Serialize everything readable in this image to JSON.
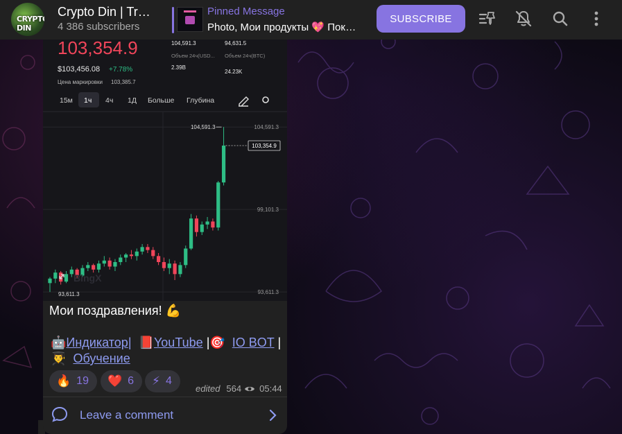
{
  "header": {
    "channel_title": "Crypto Din | Trading",
    "avatar_text": "CRYPTO DIN",
    "subscribers": "4 386 subscribers",
    "pinned_label": "Pinned Message",
    "pinned_text": "Photo, Мои продукты 💖 Показать все",
    "subscribe_label": "SUBSCRIBE",
    "icons": [
      "pinned-list-icon",
      "mute-icon",
      "search-icon",
      "more-vertical-icon"
    ]
  },
  "chart_screenshot": {
    "price": "103,354.9",
    "price_usd": "$103,456.08",
    "change": "+7.78%",
    "mark_price_label": "Цена маркировки",
    "mark_price": "103,385.7",
    "high_label": "",
    "high": "104,591.3",
    "low": "94,631.5",
    "vol_usd_label": "Объем 24ч(USD...",
    "vol_usd": "2.39B",
    "vol_btc_label": "Объем 24ч(BTC)",
    "vol_btc": "24.23K",
    "timeframes": [
      "15м",
      "1ч",
      "4ч",
      "1Д",
      "Больше",
      "Глубина"
    ],
    "active_timeframe": "1ч",
    "peak_label": "104,591.3",
    "low_label": "93,611.3",
    "watermark": "BingX",
    "axis_ticks": [
      "104,591.3",
      "99,101.3",
      "93,611.3"
    ],
    "current_price_tag": "103,354.9",
    "candles": [
      [
        94200,
        94600,
        93611,
        94500
      ],
      [
        94500,
        95100,
        94200,
        94900
      ],
      [
        94900,
        95000,
        94100,
        94300
      ],
      [
        94300,
        95000,
        94200,
        94800
      ],
      [
        94800,
        95300,
        94600,
        95100
      ],
      [
        95100,
        95200,
        94500,
        94700
      ],
      [
        94700,
        95400,
        94600,
        95200
      ],
      [
        95200,
        95600,
        95000,
        95400
      ],
      [
        95400,
        95500,
        94900,
        95100
      ],
      [
        95100,
        95700,
        94900,
        95500
      ],
      [
        95500,
        96000,
        95300,
        95700
      ],
      [
        95700,
        95900,
        95100,
        95300
      ],
      [
        95300,
        95800,
        95000,
        95600
      ],
      [
        95600,
        96100,
        95400,
        95900
      ],
      [
        95900,
        96200,
        95600,
        96100
      ],
      [
        96100,
        96400,
        95800,
        96000
      ],
      [
        96000,
        96500,
        95700,
        96300
      ],
      [
        96300,
        96800,
        96100,
        96600
      ],
      [
        96600,
        96800,
        96200,
        96400
      ],
      [
        96400,
        96600,
        95800,
        96000
      ],
      [
        96000,
        96200,
        95400,
        95600
      ],
      [
        95600,
        95900,
        95000,
        95200
      ],
      [
        95200,
        95800,
        94800,
        95500
      ],
      [
        95500,
        95700,
        94400,
        94800
      ],
      [
        94800,
        95600,
        94600,
        95400
      ],
      [
        95400,
        96700,
        95200,
        96500
      ],
      [
        96500,
        98800,
        96400,
        98500
      ],
      [
        98500,
        98700,
        97300,
        97600
      ],
      [
        97600,
        98300,
        97400,
        98100
      ],
      [
        98100,
        98600,
        97800,
        98300
      ],
      [
        98300,
        98500,
        97700,
        97900
      ],
      [
        97900,
        101000,
        97700,
        100900
      ],
      [
        100900,
        104591,
        100700,
        103355
      ]
    ]
  },
  "message": {
    "caption": "Мои поздравления! 💪",
    "links_prefix_emoji": "🤖",
    "link_indicator": "Индикатор",
    "sep1": "|",
    "youtube_emoji": "📕",
    "link_youtube": "YouTube",
    "sep2": "|🎯",
    "link_iobot": "IO BOT",
    "sep3": "|",
    "edu_emoji": "👨‍🎓",
    "link_learning": "Обучение",
    "reactions": [
      {
        "emoji": "🔥",
        "count": "19"
      },
      {
        "emoji": "❤️",
        "count": "6"
      },
      {
        "emoji": "⚡",
        "count": "4"
      }
    ],
    "edited": "edited",
    "views": "564",
    "time": "05:44",
    "comment_label": "Leave a comment"
  }
}
